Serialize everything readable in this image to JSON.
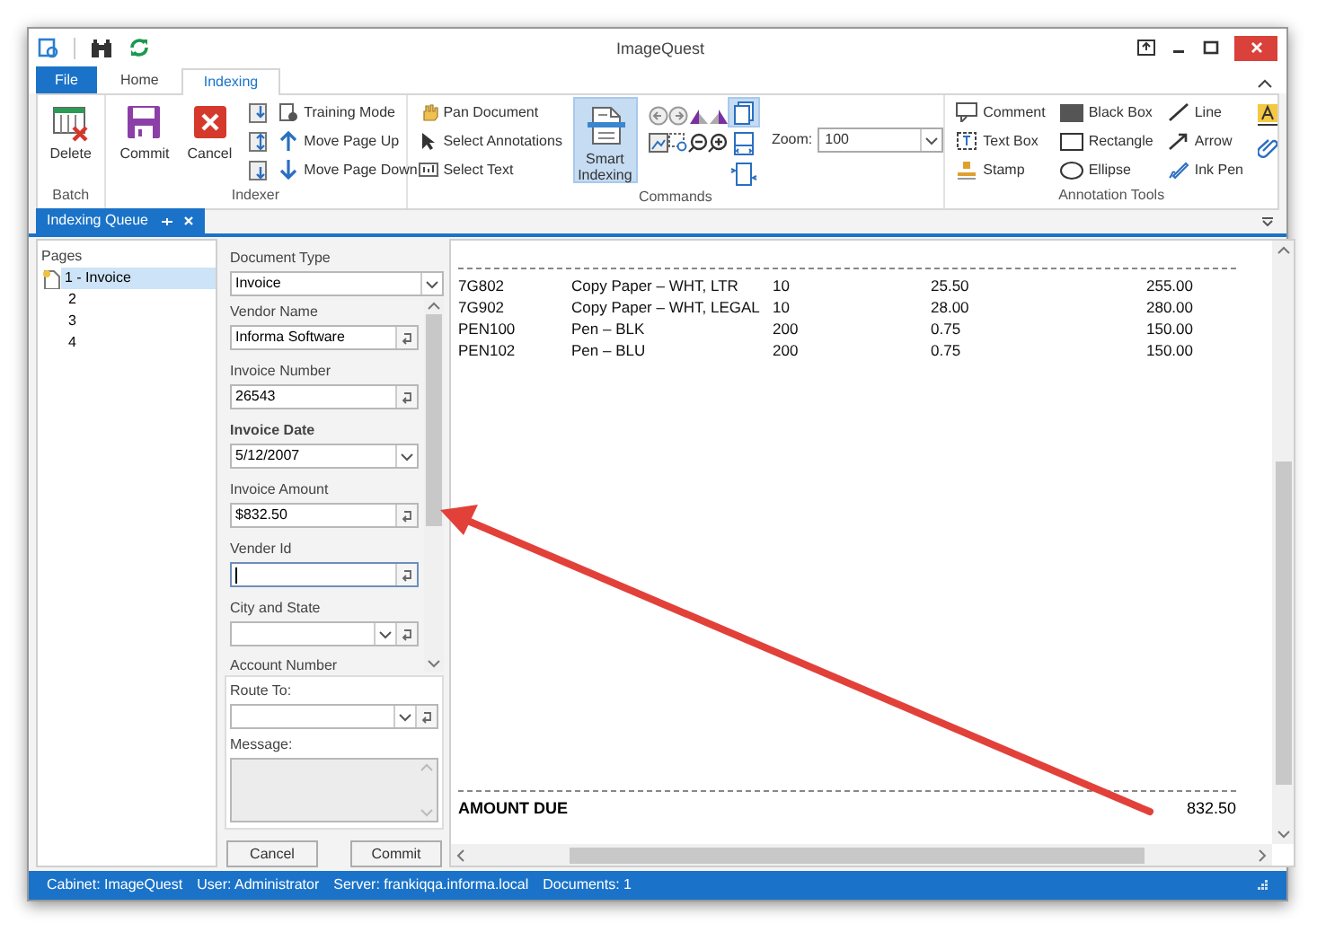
{
  "window": {
    "title": "ImageQuest"
  },
  "tabs": [
    {
      "label": "File",
      "kind": "file",
      "selected": false
    },
    {
      "label": "Home",
      "kind": "tab",
      "selected": false
    },
    {
      "label": "Indexing",
      "kind": "tab",
      "selected": true
    }
  ],
  "ribbon": {
    "batch": {
      "label": "Batch",
      "buttons": [
        "Delete"
      ]
    },
    "indexer": {
      "label": "Indexer",
      "large_buttons": [
        "Commit",
        "Cancel"
      ],
      "small_buttons": [
        "Training Mode",
        "Move Page Up",
        "Move Page Down"
      ]
    },
    "commands": {
      "label": "Commands",
      "small_buttons": [
        "Pan Document",
        "Select Annotations",
        "Select Text"
      ],
      "smart_indexing": {
        "label": "Smart Indexing",
        "selected": true
      },
      "view_buttons": [
        {
          "selected": true
        },
        {
          "selected": false
        },
        {
          "selected": false
        }
      ],
      "zoom": {
        "label": "Zoom:",
        "value": "100"
      }
    },
    "annotation_tools": {
      "label": "Annotation Tools",
      "buttons": [
        "Comment",
        "Text Box",
        "Stamp",
        "Black Box",
        "Rectangle",
        "Ellipse",
        "Line",
        "Arrow",
        "Ink Pen"
      ]
    }
  },
  "dock_tab": {
    "label": "Indexing Queue"
  },
  "pages": {
    "label": "Pages",
    "items": [
      {
        "label": "1 - Invoice",
        "kind": "document",
        "selected": true
      },
      {
        "label": "2",
        "kind": "page",
        "selected": false
      },
      {
        "label": "3",
        "kind": "page",
        "selected": false
      },
      {
        "label": "4",
        "kind": "page",
        "selected": false
      }
    ]
  },
  "document_type": {
    "label": "Document Type",
    "value": "Invoice"
  },
  "fields": [
    {
      "label": "Vendor Name",
      "value": "Informa Software",
      "kind": "text",
      "bold": false,
      "focused": false
    },
    {
      "label": "Invoice Number",
      "value": "26543",
      "kind": "text",
      "bold": false,
      "focused": false
    },
    {
      "label": "Invoice Date",
      "value": "5/12/2007",
      "kind": "date",
      "bold": true,
      "focused": false
    },
    {
      "label": "Invoice Amount",
      "value": "$832.50",
      "kind": "text",
      "bold": false,
      "focused": false
    },
    {
      "label": "Vender Id",
      "kind": "text",
      "bold": false,
      "focused": true
    },
    {
      "label": "City and State",
      "kind": "dropdown",
      "bold": false,
      "focused": false
    },
    {
      "label": "Account Number",
      "kind": "cut",
      "bold": false
    }
  ],
  "route_to": {
    "label": "Route To:"
  },
  "message": {
    "label": "Message:"
  },
  "buttons": [
    "Cancel",
    "Commit"
  ],
  "document": {
    "rows": [
      [
        "7G802",
        "Copy Paper – WHT, LTR",
        "10",
        "25.50",
        "255.00"
      ],
      [
        "7G902",
        "Copy Paper – WHT, LEGAL",
        "10",
        "28.00",
        "280.00"
      ],
      [
        "PEN100",
        "Pen – BLK",
        "200",
        "0.75",
        "150.00"
      ],
      [
        "PEN102",
        "Pen – BLU",
        "200",
        "0.75",
        "150.00"
      ]
    ],
    "total": {
      "label": "AMOUNT DUE",
      "value": "832.50"
    }
  },
  "status_bar": [
    "Cabinet: ImageQuest",
    "User: Administrator",
    "Server: frankiqqa.informa.local",
    "Documents: 1"
  ]
}
